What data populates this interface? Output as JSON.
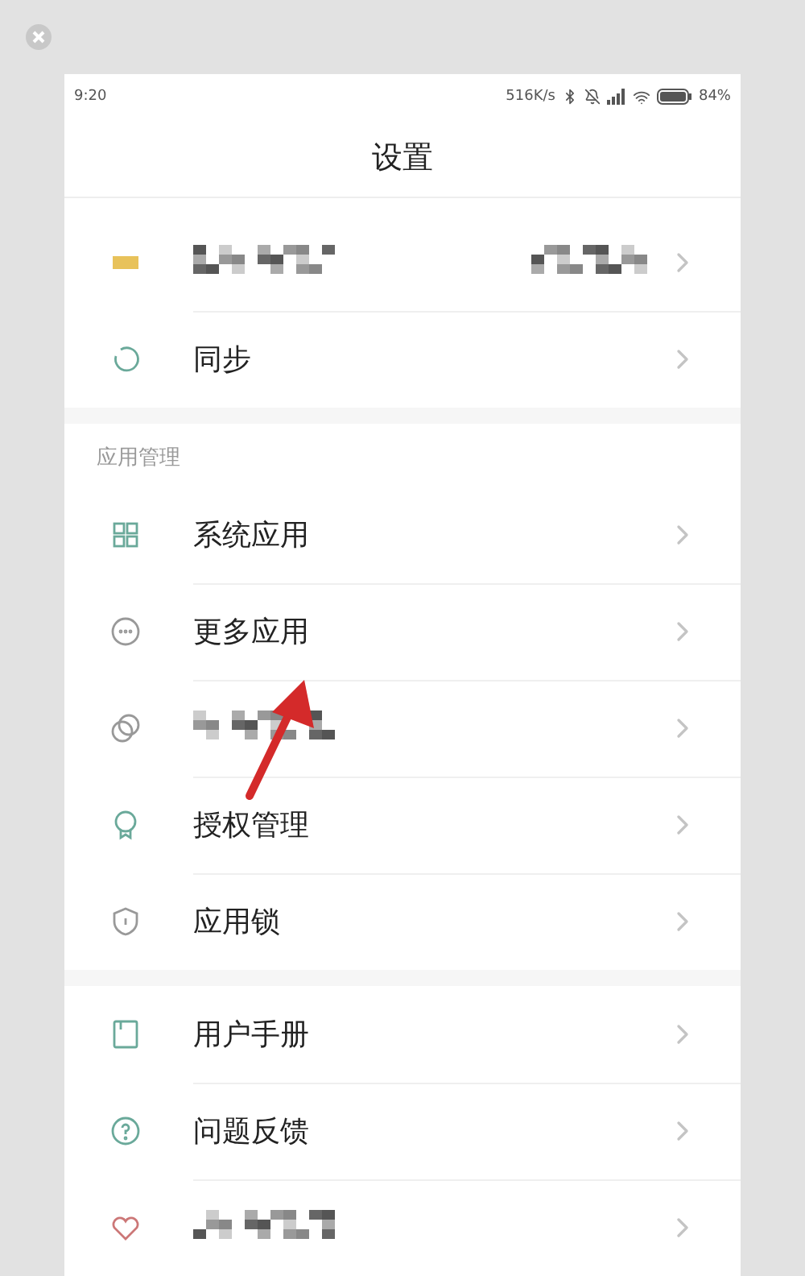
{
  "status_bar": {
    "time": "9:20",
    "speed": "516K/s",
    "battery": "84%"
  },
  "header": {
    "title": "设置"
  },
  "groups": [
    {
      "items": [
        {
          "kind": "redacted",
          "has_value": true
        },
        {
          "kind": "text",
          "label": "同步"
        }
      ]
    },
    {
      "heading": "应用管理",
      "items": [
        {
          "kind": "text",
          "label": "系统应用"
        },
        {
          "kind": "text",
          "label": "更多应用"
        },
        {
          "kind": "redacted",
          "has_value": false
        },
        {
          "kind": "text",
          "label": "授权管理"
        },
        {
          "kind": "text",
          "label": "应用锁"
        }
      ]
    },
    {
      "items": [
        {
          "kind": "text",
          "label": "用户手册"
        },
        {
          "kind": "text",
          "label": "问题反馈"
        },
        {
          "kind": "redacted",
          "has_value": false
        }
      ]
    }
  ]
}
